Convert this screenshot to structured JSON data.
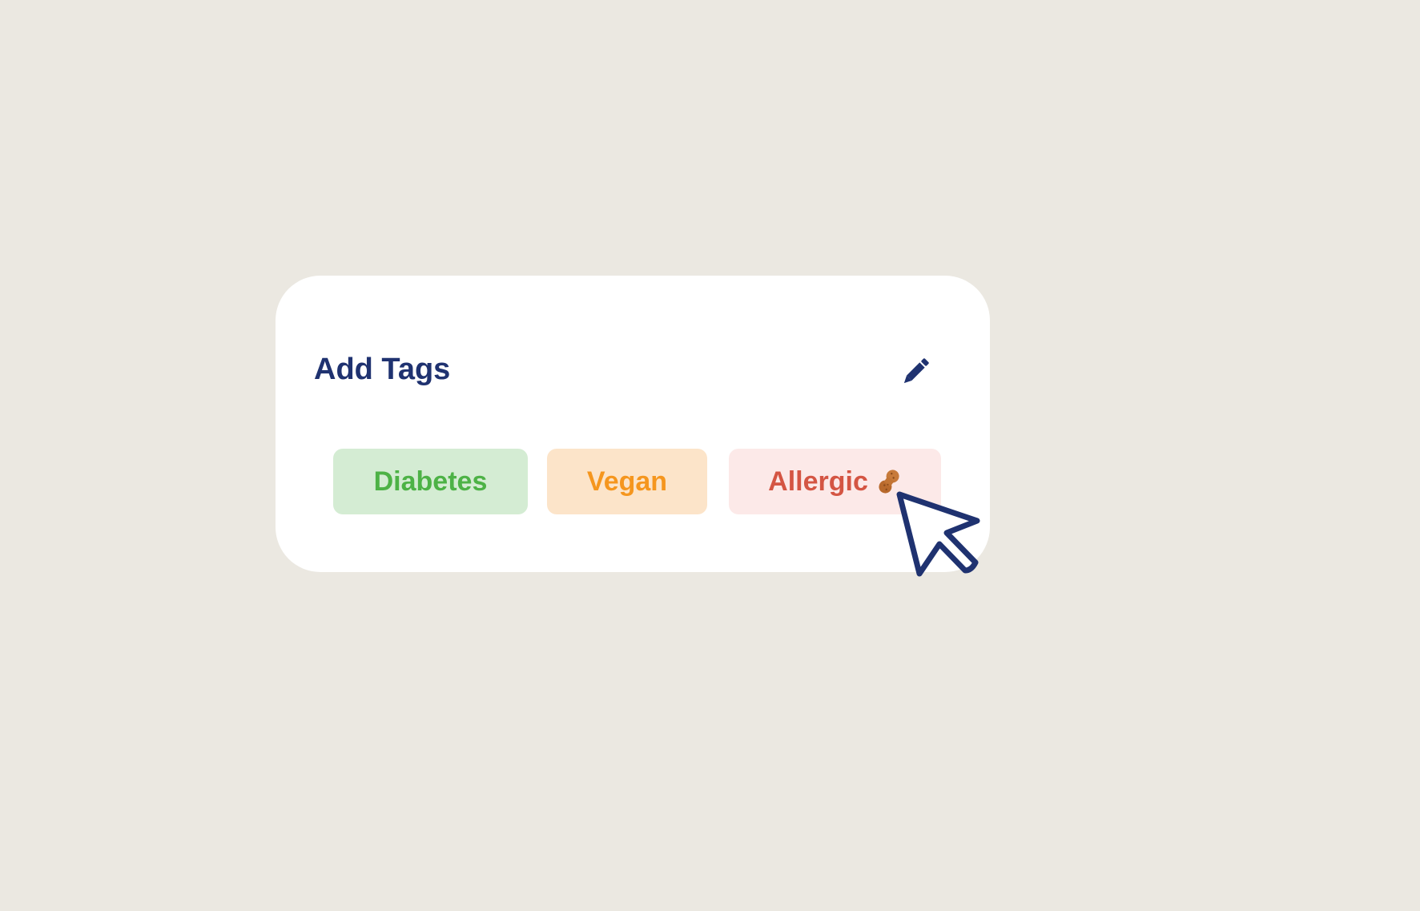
{
  "card": {
    "title": "Add Tags",
    "edit_icon": "pencil-icon"
  },
  "tags": [
    {
      "label": "Diabetes",
      "text_color": "#4DB246",
      "bg_color": "#D4ECD3"
    },
    {
      "label": "Vegan",
      "text_color": "#F5961E",
      "bg_color": "#FCE4C9"
    },
    {
      "label": "Allergic",
      "text_color": "#D45543",
      "bg_color": "#FCE9E8",
      "icon": "peanut-icon"
    }
  ],
  "colors": {
    "background": "#EBE8E1",
    "card": "#FFFFFF",
    "accent": "#1F3270"
  },
  "cursor": {
    "icon": "pointer-cursor-icon"
  }
}
